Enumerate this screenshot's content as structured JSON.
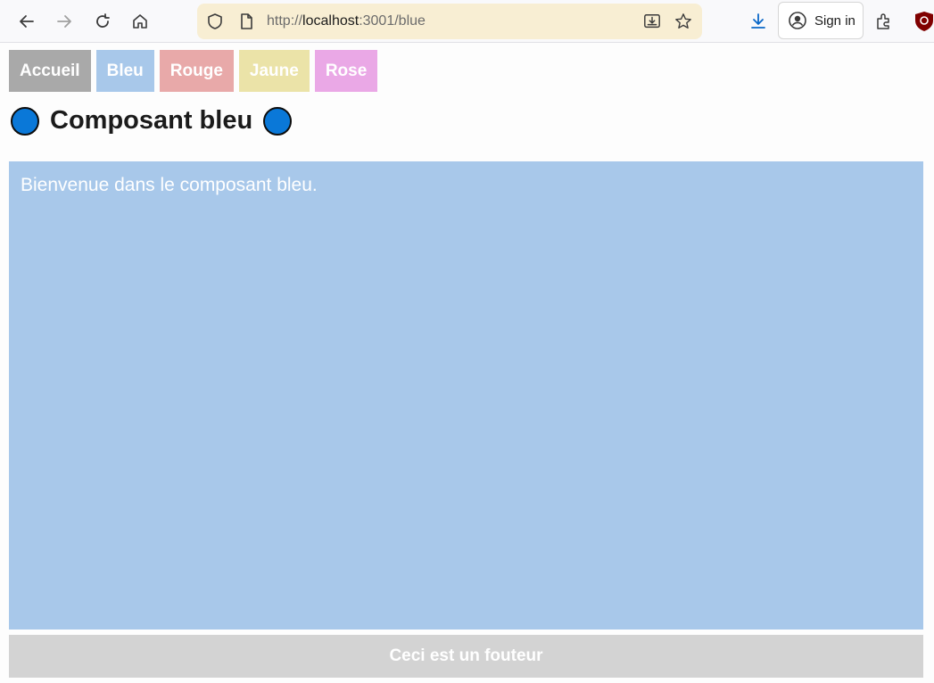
{
  "browser": {
    "url_scheme": "http://",
    "url_host": "localhost",
    "url_rest": ":3001/blue",
    "signin_label": "Sign in"
  },
  "nav": {
    "items": [
      {
        "label": "Accueil",
        "color": "#a9a9a9"
      },
      {
        "label": "Bleu",
        "color": "#a8c8ea"
      },
      {
        "label": "Rouge",
        "color": "#e8a9a9"
      },
      {
        "label": "Jaune",
        "color": "#ebe3a8"
      },
      {
        "label": "Rose",
        "color": "#eaa8e6"
      }
    ]
  },
  "page": {
    "title": "Composant bleu",
    "content_text": "Bienvenue dans le composant bleu.",
    "footer_text": "Ceci est un fouteur",
    "accent_color": "#0a78d8"
  }
}
